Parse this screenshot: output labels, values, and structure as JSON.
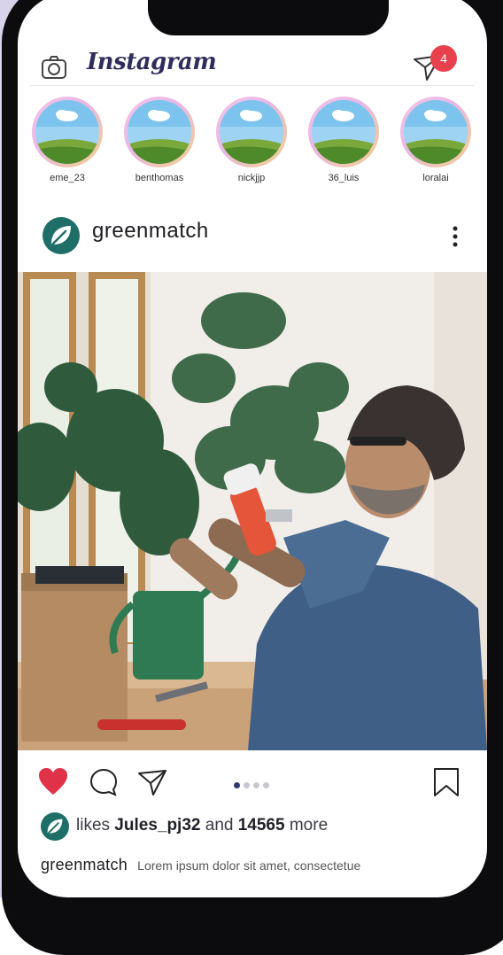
{
  "app": {
    "logo_text": "Instagram"
  },
  "header": {
    "notification_count": "4"
  },
  "stories": [
    {
      "name": "eme_23"
    },
    {
      "name": "benthomas"
    },
    {
      "name": "nickjjp"
    },
    {
      "name": "36_luis"
    },
    {
      "name": "loralai"
    }
  ],
  "post": {
    "username": "greenmatch",
    "carousel": {
      "count": 4,
      "active_index": 0
    },
    "likes": {
      "prefix": "likes",
      "user": "Jules_pj32",
      "connector": "and",
      "count": "14565",
      "suffix": "more"
    },
    "caption": {
      "user": "greenmatch",
      "text": "Lorem ipsum dolor sit amet, consectetue"
    }
  },
  "colors": {
    "brand_text": "#2f2d5a",
    "badge": "#e8404d",
    "heart": "#e0334a",
    "avatar_green": "#1f6e68"
  },
  "icons": {
    "camera": "camera-icon",
    "direct": "send-icon",
    "more": "more-vertical-icon",
    "like": "heart-icon",
    "comment": "comment-icon",
    "share": "share-icon",
    "save": "bookmark-icon"
  }
}
